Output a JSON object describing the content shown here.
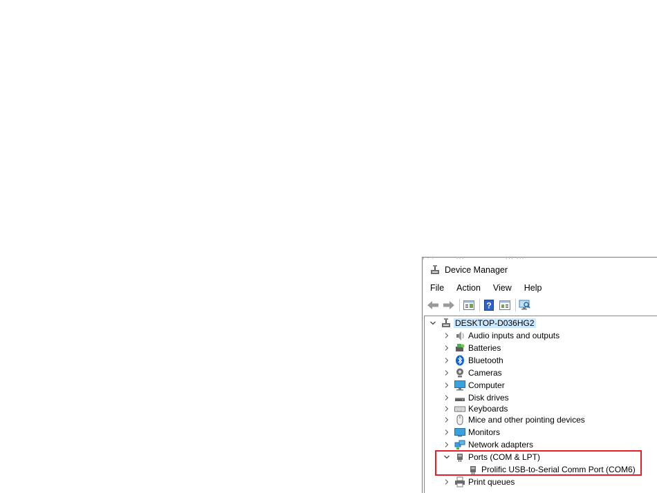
{
  "window": {
    "title": "Device Manager"
  },
  "menu": {
    "items": [
      "File",
      "Action",
      "View",
      "Help"
    ]
  },
  "toolbar": {
    "buttons": [
      "back-icon",
      "forward-icon",
      "properties-icon",
      "help-icon",
      "update-driver-icon",
      "scan-hardware-icon"
    ]
  },
  "tree": {
    "root": "DESKTOP-D036HG2",
    "categories": [
      {
        "label": "Audio inputs and outputs",
        "icon": "speaker-icon",
        "expanded": false
      },
      {
        "label": "Batteries",
        "icon": "battery-icon",
        "expanded": false
      },
      {
        "label": "Bluetooth",
        "icon": "bluetooth-icon",
        "expanded": false
      },
      {
        "label": "Cameras",
        "icon": "camera-icon",
        "expanded": false
      },
      {
        "label": "Computer",
        "icon": "computer-icon",
        "expanded": false
      },
      {
        "label": "Disk drives",
        "icon": "disk-drive-icon",
        "expanded": false
      },
      {
        "label": "Keyboards",
        "icon": "keyboard-icon",
        "expanded": false
      },
      {
        "label": "Mice and other pointing devices",
        "icon": "mouse-icon",
        "expanded": false
      },
      {
        "label": "Monitors",
        "icon": "monitor-icon",
        "expanded": false
      },
      {
        "label": "Network adapters",
        "icon": "network-adapter-icon",
        "expanded": false
      },
      {
        "label": "Ports (COM & LPT)",
        "icon": "port-icon",
        "expanded": true,
        "children": [
          {
            "label": "Prolific USB-to-Serial Comm Port (COM6)",
            "icon": "port-icon"
          }
        ]
      },
      {
        "label": "Print queues",
        "icon": "printer-icon",
        "expanded": false
      }
    ]
  },
  "colors": {
    "highlight": "#e3202a",
    "selection": "#cce8ff",
    "bluetooth": "#0a64d8"
  }
}
